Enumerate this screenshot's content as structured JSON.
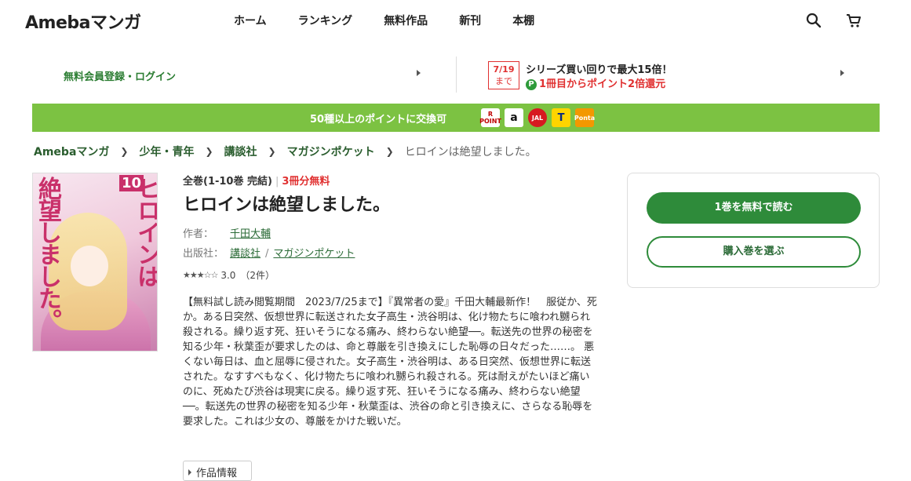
{
  "header": {
    "logo": "Amebaマンガ",
    "nav": [
      "ホーム",
      "ランキング",
      "無料作品",
      "新刊",
      "本棚"
    ],
    "search_icon": "search-icon",
    "cart_icon": "cart-icon"
  },
  "info_bar": {
    "login": "無料会員登録・ログイン",
    "campaign_date": "7/19",
    "campaign_until": "まで",
    "promo_line1": "シリーズ買い回りで最大15倍！",
    "promo_badge": "P",
    "promo_line2": "1冊目からポイント2倍還元"
  },
  "banner": {
    "text": "50種以上のポイントに交換可",
    "logos": [
      "R POINT",
      "a",
      "JAL",
      "T",
      "Ponta"
    ]
  },
  "breadcrumb": {
    "items": [
      "Amebaマンガ",
      "少年・青年",
      "講談社",
      "マガジンポケット"
    ],
    "current": "ヒロインは絶望しました。"
  },
  "cover": {
    "title_right": "ヒロインは",
    "title_left": "絶望しました。",
    "volume": "10"
  },
  "work": {
    "volumes": "全巻(1-10巻 完結)",
    "divider": "|",
    "free": "3冊分無料",
    "title": "ヒロインは絶望しました。",
    "author_label": "作者：",
    "author": "千田大輔",
    "publisher_label": "出版社：",
    "publisher": "講談社",
    "imprint": "マガジンポケット",
    "stars": "★★★☆☆",
    "rating": 3.0,
    "rating_text": "3.0",
    "review_count": "（2件）",
    "description": "【無料試し読み閲覧期間　2023/7/25まで】『異常者の愛』千田大輔最新作！　服従か、死か。ある日突然、仮想世界に転送された女子高生・渋谷明は、化け物たちに喰われ嬲られ殺される。繰り返す死、狂いそうになる痛み、終わらない絶望──。転送先の世界の秘密を知る少年・秋葉歪が要求したのは、命と尊厳を引き換えにした恥辱の日々だった……。 悪くない毎日は、血と屈辱に侵された。女子高生・渋谷明は、ある日突然、仮想世界に転送された。なすすべもなく、化け物たちに喰われ嬲られ殺される。死は耐えがたいほど痛いのに、死ぬたび渋谷は現実に戻る。繰り返す死、狂いそうになる痛み、終わらない絶望──。転送先の世界の秘密を知る少年・秋葉歪は、渋谷の命と引き換えに、さらなる恥辱を要求した。これは少女の、尊厳をかけた戦いだ。",
    "info_button": "作品情報"
  },
  "actions": {
    "read_free": "1巻を無料で読む",
    "choose_buy": "購入巻を選ぶ"
  },
  "colors": {
    "brand_green": "#2e8b3a",
    "banner_green": "#7cc242",
    "accent_red": "#e03030"
  }
}
